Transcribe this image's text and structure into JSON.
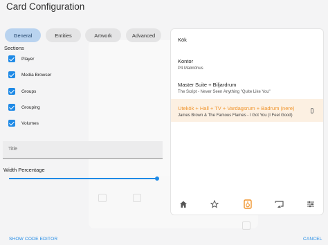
{
  "dialog": {
    "title": "Card Configuration"
  },
  "tabs": [
    {
      "label": "General",
      "active": true
    },
    {
      "label": "Entities",
      "active": false
    },
    {
      "label": "Artwork",
      "active": false
    },
    {
      "label": "Advanced",
      "active": false
    }
  ],
  "sections": {
    "label": "Sections",
    "items": [
      {
        "label": "Player",
        "checked": true
      },
      {
        "label": "Media Browser",
        "checked": true
      },
      {
        "label": "Groups",
        "checked": true
      },
      {
        "label": "Grouping",
        "checked": true
      },
      {
        "label": "Volumes",
        "checked": true
      }
    ]
  },
  "title_field": {
    "label": "Title",
    "value": ""
  },
  "width": {
    "label": "Width Percentage",
    "value_fraction": 1.0
  },
  "footer": {
    "show_code_editor": "SHOW CODE EDITOR",
    "cancel": "CANCEL"
  },
  "preview": {
    "players": [
      {
        "name": "Kök",
        "sub": ""
      },
      {
        "name": "Kontor",
        "sub": "P4 Malmöhus"
      },
      {
        "name": "Master Suite + Biljardrum",
        "sub": "The Script - Never Seen Anything \"Quite Like You\""
      },
      {
        "name": "Utekök + Hall + TV + Vardagsrum + Badrum (nere)",
        "sub": "James Brown & The Famous Flames - I Got You (I Feel Good)",
        "active": true,
        "icon": "thermometer-icon"
      }
    ],
    "nav_icons": [
      "home-icon",
      "star-icon",
      "speaker-icon",
      "cast-icon",
      "sliders-icon"
    ],
    "accent_color": "#f0942c"
  },
  "colors": {
    "primary": "#1f8ae6",
    "tab_active_bg": "#b9d3ef"
  }
}
